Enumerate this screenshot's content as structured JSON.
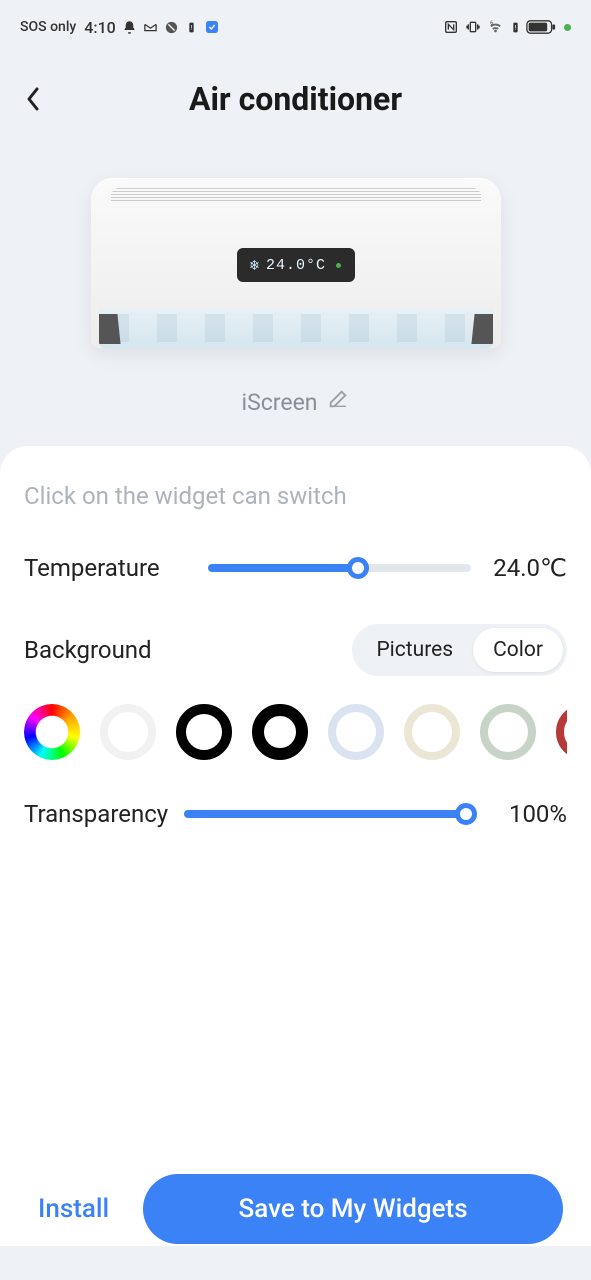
{
  "status": {
    "carrier": "SOS only",
    "time": "4:10"
  },
  "header": {
    "title": "Air conditioner"
  },
  "preview": {
    "display_temp": "24.0°C",
    "brand": "iScreen"
  },
  "panel": {
    "hint": "Click on the widget can switch",
    "temperature": {
      "label": "Temperature",
      "value": "24.0℃",
      "percent": 57
    },
    "background": {
      "label": "Background",
      "options": {
        "pictures": "Pictures",
        "color": "Color"
      },
      "active": "color"
    },
    "colors": [
      {
        "id": "rainbow"
      },
      {
        "id": "softwhite"
      },
      {
        "id": "black1"
      },
      {
        "id": "black2"
      },
      {
        "id": "lightblue"
      },
      {
        "id": "cream"
      },
      {
        "id": "sage"
      },
      {
        "id": "redpartial"
      }
    ],
    "transparency": {
      "label": "Transparency",
      "value": "100%",
      "percent": 100
    }
  },
  "footer": {
    "install": "Install",
    "save": "Save to My Widgets"
  }
}
